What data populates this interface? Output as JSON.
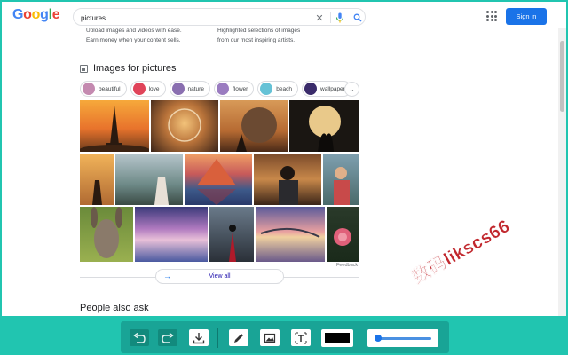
{
  "header": {
    "logo_letters": [
      {
        "ch": "G",
        "color": "#4285F4"
      },
      {
        "ch": "o",
        "color": "#EA4335"
      },
      {
        "ch": "o",
        "color": "#FBBC05"
      },
      {
        "ch": "g",
        "color": "#4285F4"
      },
      {
        "ch": "l",
        "color": "#34A853"
      },
      {
        "ch": "e",
        "color": "#EA4335"
      }
    ],
    "search_value": "pictures",
    "clear_glyph": "✕",
    "signin_label": "Sign in"
  },
  "snippet": {
    "left_line1": "Upload images and videos with ease.",
    "left_line2": "Earn money when your content sells.",
    "right_line1": "Highlighted selections of images",
    "right_line2": "from our most inspiring artists."
  },
  "images": {
    "heading": "Images for pictures",
    "chips": [
      {
        "label": "beautiful",
        "color": "#c48ab0"
      },
      {
        "label": "love",
        "color": "#e0445a"
      },
      {
        "label": "nature",
        "color": "#8a6fb0"
      },
      {
        "label": "flower",
        "color": "#9a7cc0"
      },
      {
        "label": "beach",
        "color": "#66c2d6"
      },
      {
        "label": "wallpaper",
        "color": "#3a2b6a"
      }
    ],
    "more_glyph": "⌄",
    "feedback": "Feedback",
    "view_all": "View all",
    "view_all_arrow": "→"
  },
  "paa_heading": "People also ask",
  "watermark": "数码likscs66",
  "toolbar": {
    "accent": "#19a496",
    "tools": [
      "undo-icon",
      "redo-icon",
      "download-icon",
      "pencil-icon",
      "image-crop-icon",
      "text-icon"
    ],
    "stroke_color": "#000000",
    "slider_level": 0.05
  }
}
